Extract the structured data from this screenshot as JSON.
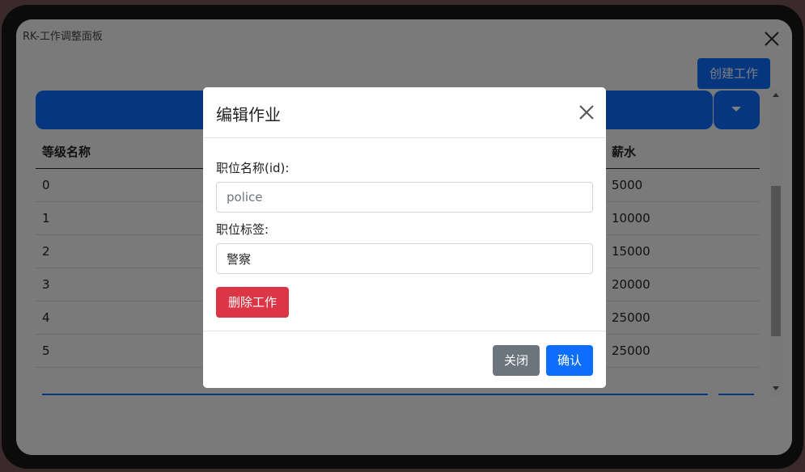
{
  "window": {
    "title": "RK-工作调整面板"
  },
  "toolbar": {
    "create_label": "创建工作"
  },
  "table": {
    "headers": [
      "等级名称",
      "薪水"
    ],
    "rows": [
      {
        "grade": "0",
        "salary": "5000"
      },
      {
        "grade": "1",
        "salary": "10000"
      },
      {
        "grade": "2",
        "salary": "15000"
      },
      {
        "grade": "3",
        "salary": "20000"
      },
      {
        "grade": "4",
        "salary": "25000"
      },
      {
        "grade": "5",
        "salary": "25000"
      }
    ]
  },
  "modal": {
    "title": "编辑作业",
    "name_label": "职位名称(id):",
    "name_placeholder": "police",
    "tag_label": "职位标签:",
    "tag_value": "警察",
    "delete_label": "删除工作",
    "close_label": "关闭",
    "confirm_label": "确认"
  },
  "colors": {
    "primary": "#0d6efd",
    "danger": "#dc3545",
    "secondary": "#6c757d"
  },
  "icons": {
    "window_close": "close-icon",
    "modal_close": "close-icon",
    "dropdown": "caret-down-icon"
  }
}
